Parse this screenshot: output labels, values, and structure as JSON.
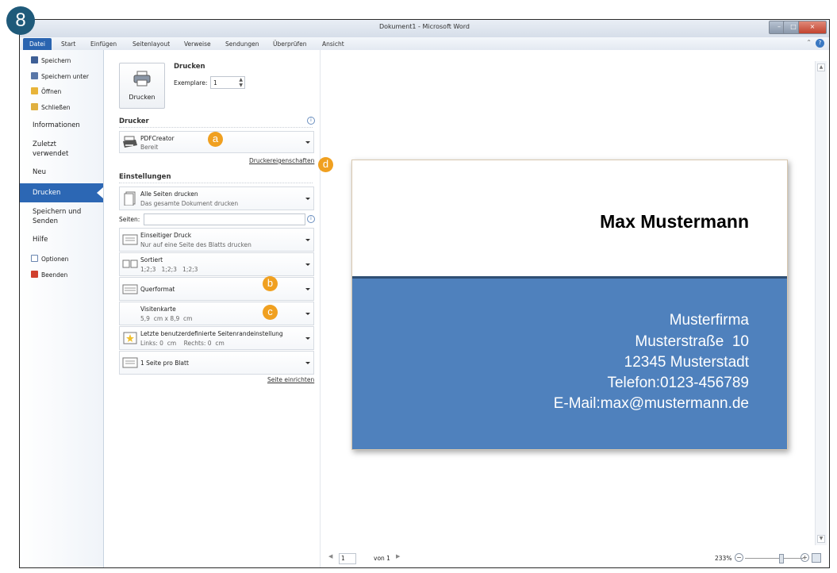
{
  "step": "8",
  "window": {
    "title": "Dokument1 - Microsoft Word",
    "controls": [
      "–",
      "□",
      "×"
    ]
  },
  "ribbon": {
    "tabs": [
      "Datei",
      "Start",
      "Einfügen",
      "Seitenlayout",
      "Verweise",
      "Sendungen",
      "Überprüfen",
      "Ansicht"
    ],
    "help": "?"
  },
  "backstage": {
    "items": {
      "save": "Speichern",
      "save_as": "Speichern unter",
      "open": "Öffnen",
      "close": "Schließen",
      "info": "Informationen",
      "recent_1": "Zuletzt",
      "recent_2": "verwendet",
      "new": "Neu",
      "print": "Drucken",
      "send_1": "Speichern und",
      "send_2": "Senden",
      "help": "Hilfe",
      "options": "Optionen",
      "exit": "Beenden"
    }
  },
  "print": {
    "heading": "Drucken",
    "button_label": "Drucken",
    "copies_label": "Exemplare:",
    "copies_value": "1",
    "printer_heading": "Drucker",
    "printer_name": "PDFCreator",
    "printer_status": "Bereit",
    "printer_properties": "Druckereigenschaften",
    "settings_heading": "Einstellungen",
    "pages_label": "Seiten:",
    "pages_value": "",
    "page_setup": "Seite einrichten",
    "settings": {
      "range_1": "Alle Seiten drucken",
      "range_2": "Das gesamte Dokument drucken",
      "sides_1": "Einseitiger Druck",
      "sides_2": "Nur auf eine Seite des Blatts drucken",
      "collate_1": "Sortiert",
      "collate_2": "1;2;3   1;2;3   1;2;3",
      "orientation_1": "Querformat",
      "size_1": "Visitenkarte",
      "size_2": "5,9  cm x 8,9  cm",
      "margins_1": "Letzte benutzerdefinierte Seitenrandeinstellung",
      "margins_2": "Links: 0  cm    Rechts: 0  cm",
      "pages_per_sheet_1": "1 Seite pro Blatt"
    }
  },
  "callouts": {
    "a": "a",
    "b": "b",
    "c": "c",
    "d": "d"
  },
  "card": {
    "name": "Max Mustermann",
    "company": "Musterfirma",
    "street": "Musterstraße  10",
    "city": "12345 Musterstadt",
    "phone": "Telefon:0123-456789",
    "email": "E-Mail:max@mustermann.de"
  },
  "status": {
    "page": "1",
    "of": "von 1",
    "zoom": "233%"
  },
  "colors": {
    "accent_blue": "#2c67b4",
    "card_blue": "#4f81bd",
    "callout_orange": "#f0a020",
    "badge": "#1f5a7a"
  }
}
